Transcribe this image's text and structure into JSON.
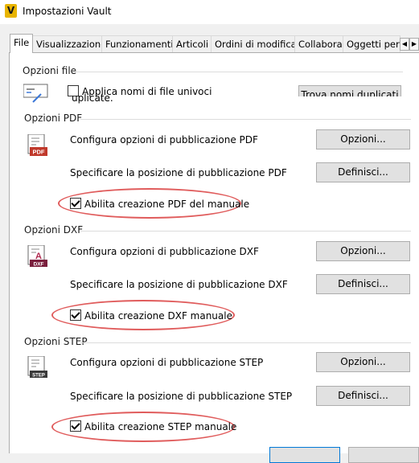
{
  "window": {
    "app_icon_letter": "V",
    "title": "Impostazioni Vault"
  },
  "tabs": [
    {
      "label": "File",
      "active": true
    },
    {
      "label": "Visualizzazione"
    },
    {
      "label": "Funzionamenti"
    },
    {
      "label": "Articoli"
    },
    {
      "label": "Ordini di modifica"
    },
    {
      "label": "Collabora"
    },
    {
      "label": "Oggetti pers"
    }
  ],
  "file_options": {
    "title": "Opzioni file",
    "unique_names_checkbox": "Applica nomi di file univoci",
    "unique_names_overflow": "uplicate.",
    "find_duplicates_button": "Trova nomi duplicati"
  },
  "pdf": {
    "title": "Opzioni PDF",
    "configure_label": "Configura opzioni di pubblicazione PDF",
    "configure_button": "Opzioni...",
    "location_label": "Specificare la posizione di pubblicazione PDF",
    "location_button": "Definisci...",
    "manual_checkbox": "Abilita creazione PDF del manuale",
    "icon_badge": "PDF"
  },
  "dxf": {
    "title": "Opzioni DXF",
    "configure_label": "Configura opzioni di pubblicazione DXF",
    "configure_button": "Opzioni...",
    "location_label": "Specificare la posizione di pubblicazione DXF",
    "location_button": "Definisci...",
    "manual_checkbox": "Abilita creazione DXF manuale",
    "icon_badge": "DXF",
    "icon_letter": "A"
  },
  "step": {
    "title": "Opzioni STEP",
    "configure_label": "Configura opzioni di pubblicazione STEP",
    "configure_button": "Opzioni...",
    "location_label": "Specificare la posizione di pubblicazione STEP",
    "location_button": "Definisci...",
    "manual_checkbox": "Abilita creazione STEP manuale",
    "icon_badge": "STEP"
  },
  "colors": {
    "highlight_ellipse": "#e05c5c",
    "pdf_badge": "#c0392b",
    "dxf_badge": "#7a1f3d",
    "step_badge": "#3a3a3a"
  }
}
